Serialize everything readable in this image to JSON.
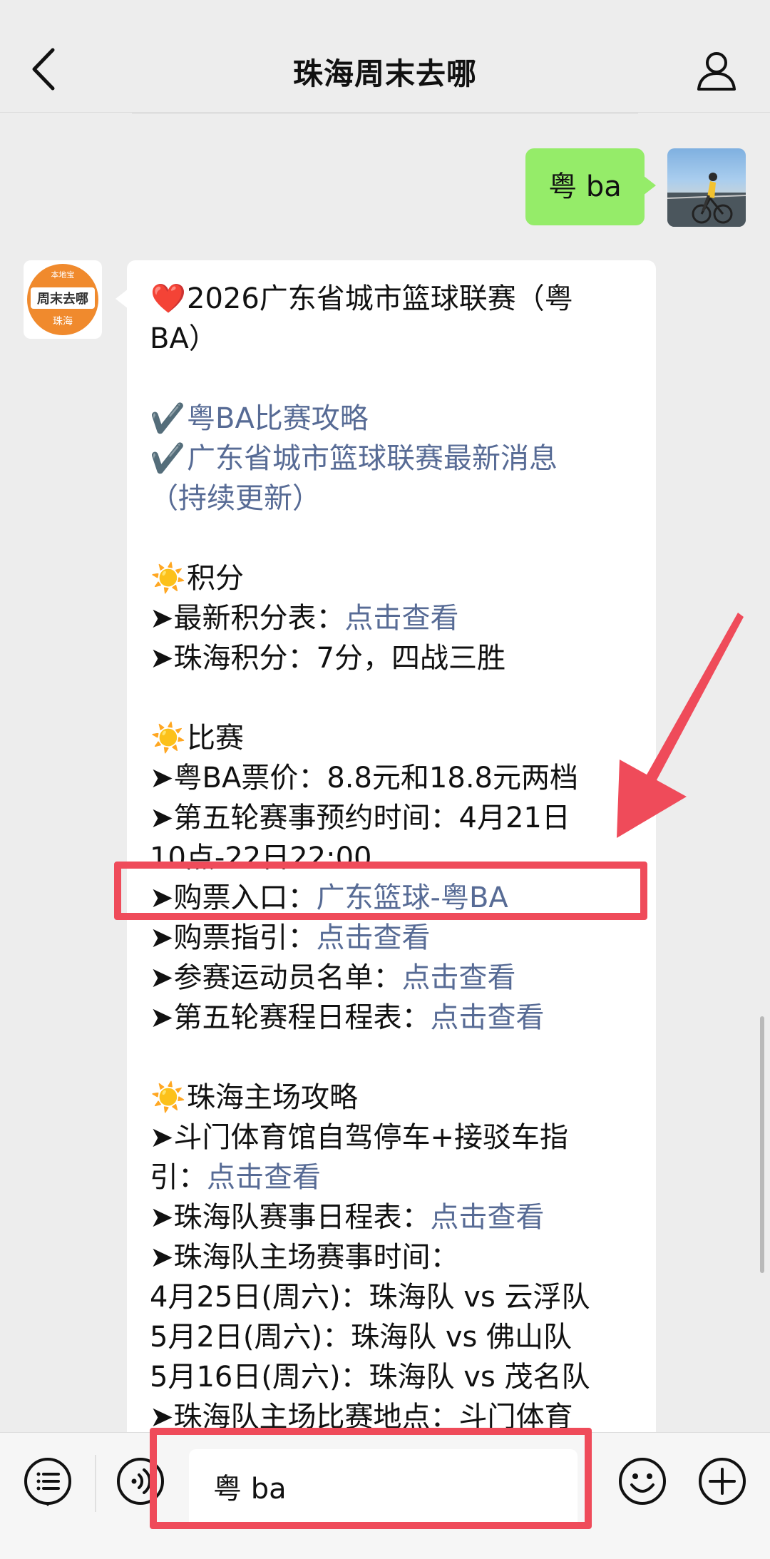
{
  "header": {
    "title": "珠海周末去哪"
  },
  "outgoing": {
    "text": "粤 ba"
  },
  "incoming": {
    "avatar": {
      "badge": "本地宝",
      "brand": "周末去哪",
      "city": "珠海"
    },
    "lines": [
      {
        "parts": [
          {
            "t": "❤️",
            "emo": true
          },
          {
            "t": "2026广东省城市篮球联赛（粤"
          }
        ]
      },
      {
        "parts": [
          {
            "t": "BA）"
          }
        ]
      },
      {
        "parts": []
      },
      {
        "parts": [
          {
            "t": "✔️ ",
            "emo": true
          },
          {
            "t": "粤BA比赛攻略",
            "link": true
          }
        ]
      },
      {
        "parts": [
          {
            "t": "✔️ ",
            "emo": true
          },
          {
            "t": "广东省城市篮球联赛最新消息",
            "link": true
          }
        ]
      },
      {
        "parts": [
          {
            "t": "（持续更新）",
            "link": true
          }
        ]
      },
      {
        "parts": []
      },
      {
        "parts": [
          {
            "t": "☀️",
            "emo": true
          },
          {
            "t": "积分"
          }
        ]
      },
      {
        "parts": [
          {
            "t": "➤最新积分表："
          },
          {
            "t": "点击查看",
            "link": true
          }
        ]
      },
      {
        "parts": [
          {
            "t": "➤珠海积分：7分，四战三胜"
          }
        ]
      },
      {
        "parts": []
      },
      {
        "parts": [
          {
            "t": "☀️",
            "emo": true
          },
          {
            "t": "比赛"
          }
        ]
      },
      {
        "parts": [
          {
            "t": "➤粤BA票价：8.8元和18.8元两档"
          }
        ]
      },
      {
        "parts": [
          {
            "t": "➤第五轮赛事预约时间：4月21日"
          }
        ]
      },
      {
        "parts": [
          {
            "t": "10点-22日22:00"
          }
        ]
      },
      {
        "parts": [
          {
            "t": "➤购票入口："
          },
          {
            "t": "广东篮球-粤BA",
            "link": true
          }
        ]
      },
      {
        "parts": [
          {
            "t": "➤购票指引："
          },
          {
            "t": "点击查看",
            "link": true
          }
        ]
      },
      {
        "parts": [
          {
            "t": "➤参赛运动员名单："
          },
          {
            "t": "点击查看",
            "link": true
          }
        ]
      },
      {
        "parts": [
          {
            "t": "➤第五轮赛程日程表："
          },
          {
            "t": "点击查看",
            "link": true
          }
        ]
      },
      {
        "parts": []
      },
      {
        "parts": [
          {
            "t": "☀️",
            "emo": true
          },
          {
            "t": "珠海主场攻略"
          }
        ]
      },
      {
        "parts": [
          {
            "t": "➤斗门体育馆自驾停车+接驳车指"
          }
        ]
      },
      {
        "parts": [
          {
            "t": "引："
          },
          {
            "t": "点击查看",
            "link": true
          }
        ]
      },
      {
        "parts": [
          {
            "t": "➤珠海队赛事日程表："
          },
          {
            "t": "点击查看",
            "link": true
          }
        ]
      },
      {
        "parts": [
          {
            "t": "➤珠海队主场赛事时间："
          }
        ]
      },
      {
        "parts": [
          {
            "t": "4月25日(周六)：珠海队 vs 云浮队"
          }
        ]
      },
      {
        "parts": [
          {
            "t": "5月2日(周六)：珠海队 vs 佛山队"
          }
        ]
      },
      {
        "parts": [
          {
            "t": "5月16日(周六)：珠海队 vs 茂名队"
          }
        ]
      },
      {
        "parts": [
          {
            "t": "➤珠海队主场比赛地点：斗门体育"
          }
        ]
      }
    ]
  },
  "input": {
    "value": "粤 ba"
  },
  "colors": {
    "link": "#576b95",
    "outgoing_bubble": "#95ec69",
    "highlight": "#ef4b5a"
  },
  "icons": [
    "back-arrow-icon",
    "profile-icon",
    "menu-list-icon",
    "voice-icon",
    "emoji-icon",
    "plus-icon"
  ]
}
